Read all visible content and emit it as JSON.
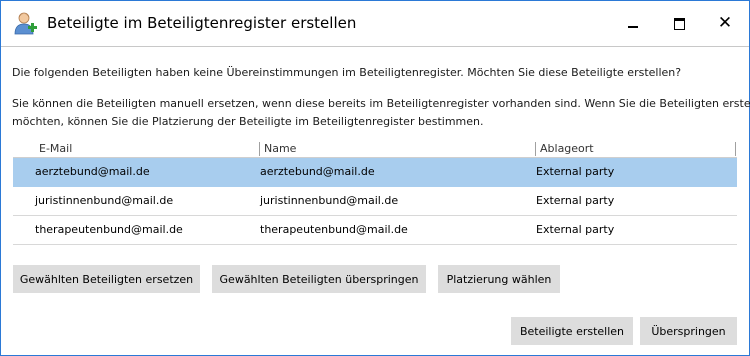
{
  "window": {
    "title": "Beteiligte im Beteiligtenregister erstellen",
    "icon": "user-add-icon",
    "controls": {
      "minimize": "minimize-icon",
      "maximize": "maximize-icon",
      "close": "close-icon"
    }
  },
  "message": {
    "line1": "Die folgenden Beteiligten haben keine Übereinstimmungen im Beteiligtenregister. Möchten Sie diese Beteiligte erstellen?",
    "line2": "Sie können die Beteiligten manuell ersetzen, wenn diese bereits im Beteiligtenregister vorhanden sind. Wenn Sie die Beteiligten erstellen",
    "line3": "möchten, können Sie die Platzierung der Beteiligte im Beteiligtenregister bestimmen."
  },
  "table": {
    "columns": [
      "E-Mail",
      "Name",
      "Ablageort"
    ],
    "rows": [
      {
        "email": "aerztebund@mail.de",
        "name": "aerztebund@mail.de",
        "location": "External party",
        "selected": true
      },
      {
        "email": "juristinnenbund@mail.de",
        "name": "juristinnenbund@mail.de",
        "location": "External party",
        "selected": false
      },
      {
        "email": "therapeutenbund@mail.de",
        "name": "therapeutenbund@mail.de",
        "location": "External party",
        "selected": false
      }
    ],
    "selection_color": "#a8cdee"
  },
  "actions": {
    "replace": "Gewählten Beteiligten ersetzen",
    "skip_selected": "Gewählten Beteiligten überspringen",
    "placement": "Platzierung wählen",
    "create": "Beteiligte erstellen",
    "skip_all": "Überspringen"
  },
  "colors": {
    "window_border": "#2b79d6",
    "button_bg": "#dddddd"
  }
}
